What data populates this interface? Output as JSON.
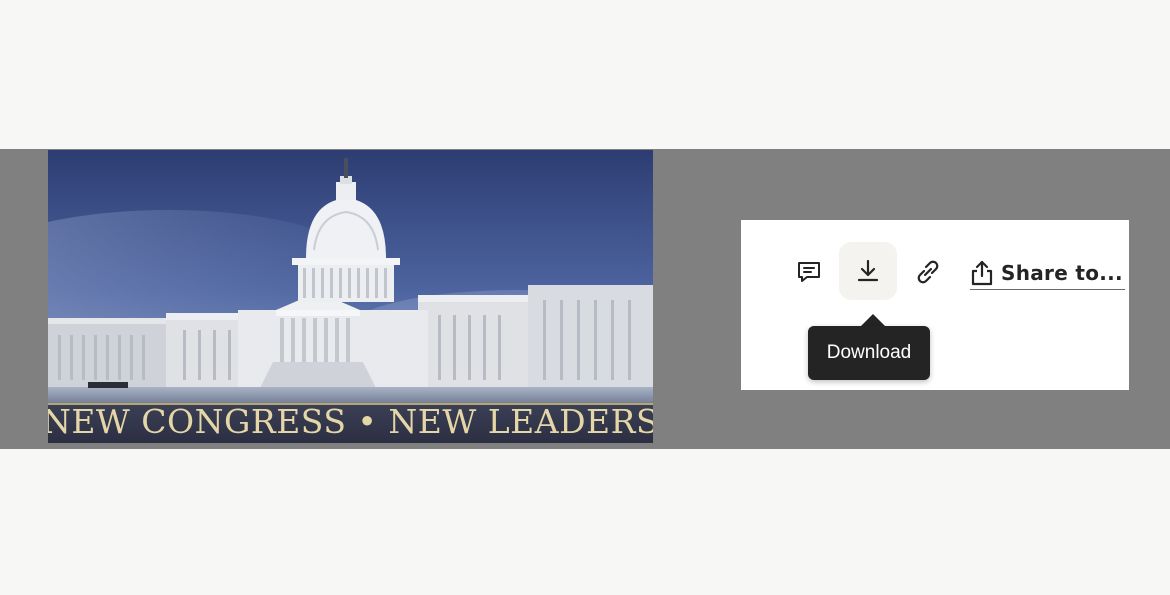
{
  "hero_image": {
    "banner_text": "NEW CONGRESS • NEW LEADERS",
    "subject": "capitol-building-photo"
  },
  "actions": {
    "comment": {
      "icon": "comment-icon"
    },
    "download": {
      "icon": "download-icon",
      "tooltip": "Download"
    },
    "copy_link": {
      "icon": "link-icon"
    },
    "share": {
      "icon": "share-icon",
      "label": "Share to..."
    }
  },
  "colors": {
    "page_background": "#f7f7f5",
    "band_background": "#808080",
    "panel_background": "#ffffff",
    "tooltip_background": "#242424",
    "icon_color": "#242424",
    "banner_text_color": "#e4d6a6"
  }
}
